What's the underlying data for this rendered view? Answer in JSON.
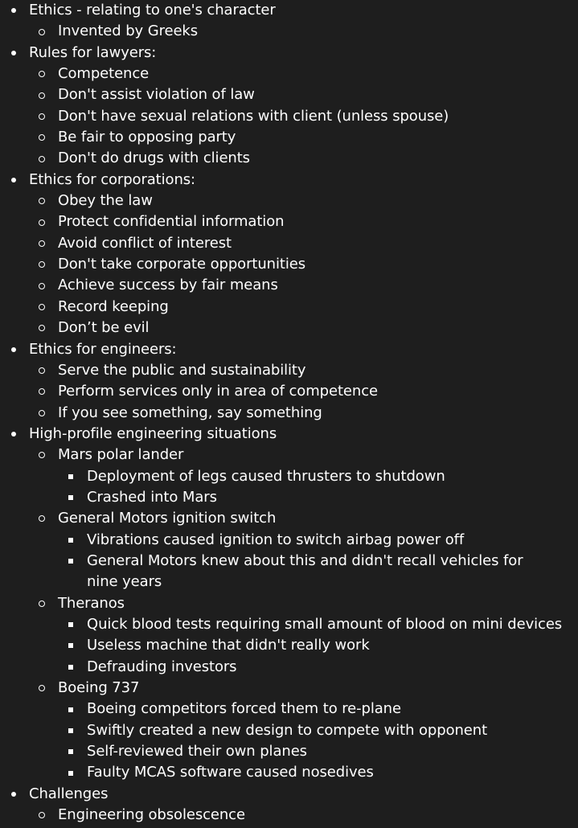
{
  "colors": {
    "background": "#1e1e1e",
    "text": "#ffffff"
  },
  "outline": [
    {
      "level": 1,
      "text": "Ethics - relating to one's character"
    },
    {
      "level": 2,
      "text": "Invented by Greeks"
    },
    {
      "level": 1,
      "text": "Rules for lawyers:"
    },
    {
      "level": 2,
      "text": "Competence"
    },
    {
      "level": 2,
      "text": "Don't assist violation of law"
    },
    {
      "level": 2,
      "text": "Don't have sexual relations with client (unless spouse)"
    },
    {
      "level": 2,
      "text": "Be fair to opposing party"
    },
    {
      "level": 2,
      "text": "Don't do drugs with clients"
    },
    {
      "level": 1,
      "text": "Ethics for corporations:"
    },
    {
      "level": 2,
      "text": "Obey the law"
    },
    {
      "level": 2,
      "text": "Protect confidential information"
    },
    {
      "level": 2,
      "text": "Avoid conflict of interest"
    },
    {
      "level": 2,
      "text": "Don't take corporate opportunities"
    },
    {
      "level": 2,
      "text": "Achieve success by fair means"
    },
    {
      "level": 2,
      "text": "Record keeping"
    },
    {
      "level": 2,
      "text": "Don’t be evil"
    },
    {
      "level": 1,
      "text": "Ethics for engineers:"
    },
    {
      "level": 2,
      "text": "Serve the public and sustainability"
    },
    {
      "level": 2,
      "text": "Perform services only in area of competence"
    },
    {
      "level": 2,
      "text": "If you see something, say something"
    },
    {
      "level": 1,
      "text": "High-profile engineering situations"
    },
    {
      "level": 2,
      "text": "Mars polar lander"
    },
    {
      "level": 3,
      "text": "Deployment of legs caused thrusters to shutdown"
    },
    {
      "level": 3,
      "text": "Crashed into Mars"
    },
    {
      "level": 2,
      "text": "General Motors ignition switch"
    },
    {
      "level": 3,
      "text": "Vibrations caused ignition to switch airbag power off"
    },
    {
      "level": 3,
      "text": "General Motors knew about this and didn't recall vehicles for nine years",
      "wrap": true
    },
    {
      "level": 2,
      "text": "Theranos"
    },
    {
      "level": 3,
      "text": "Quick blood tests requiring small amount of blood on mini devices"
    },
    {
      "level": 3,
      "text": "Useless machine that didn't really work"
    },
    {
      "level": 3,
      "text": "Defrauding investors"
    },
    {
      "level": 2,
      "text": "Boeing 737"
    },
    {
      "level": 3,
      "text": "Boeing competitors forced them to re-plane"
    },
    {
      "level": 3,
      "text": "Swiftly created a new design to compete with opponent"
    },
    {
      "level": 3,
      "text": "Self-reviewed their own planes"
    },
    {
      "level": 3,
      "text": "Faulty MCAS software caused nosedives"
    },
    {
      "level": 1,
      "text": "Challenges"
    },
    {
      "level": 2,
      "text": "Engineering obsolescence"
    }
  ]
}
